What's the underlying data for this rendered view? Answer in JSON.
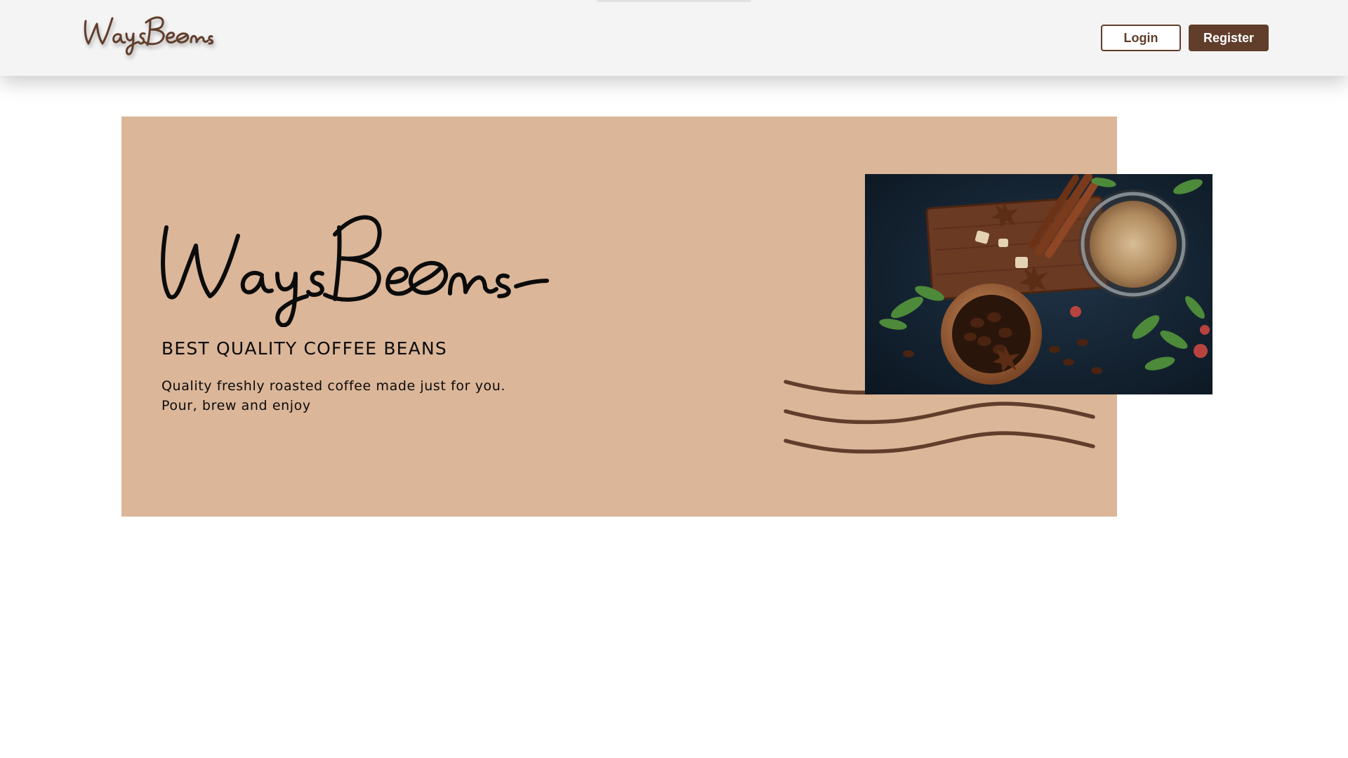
{
  "brand": {
    "name": "WaysBeans",
    "logo_icon": "coffee-bean-icon",
    "primary_color": "#613d2b",
    "hero_bg_color": "#dbb699"
  },
  "navbar": {
    "login_label": "Login",
    "register_label": "Register"
  },
  "hero": {
    "heading": "BEST QUALITY COFFEE BEANS",
    "description_lines": [
      "Quality freshly roasted coffee made just for you.",
      "Pour, brew and enjoy"
    ],
    "image_icon": "coffee-photo-image",
    "decoration_icon": "wave-lines-icon"
  }
}
